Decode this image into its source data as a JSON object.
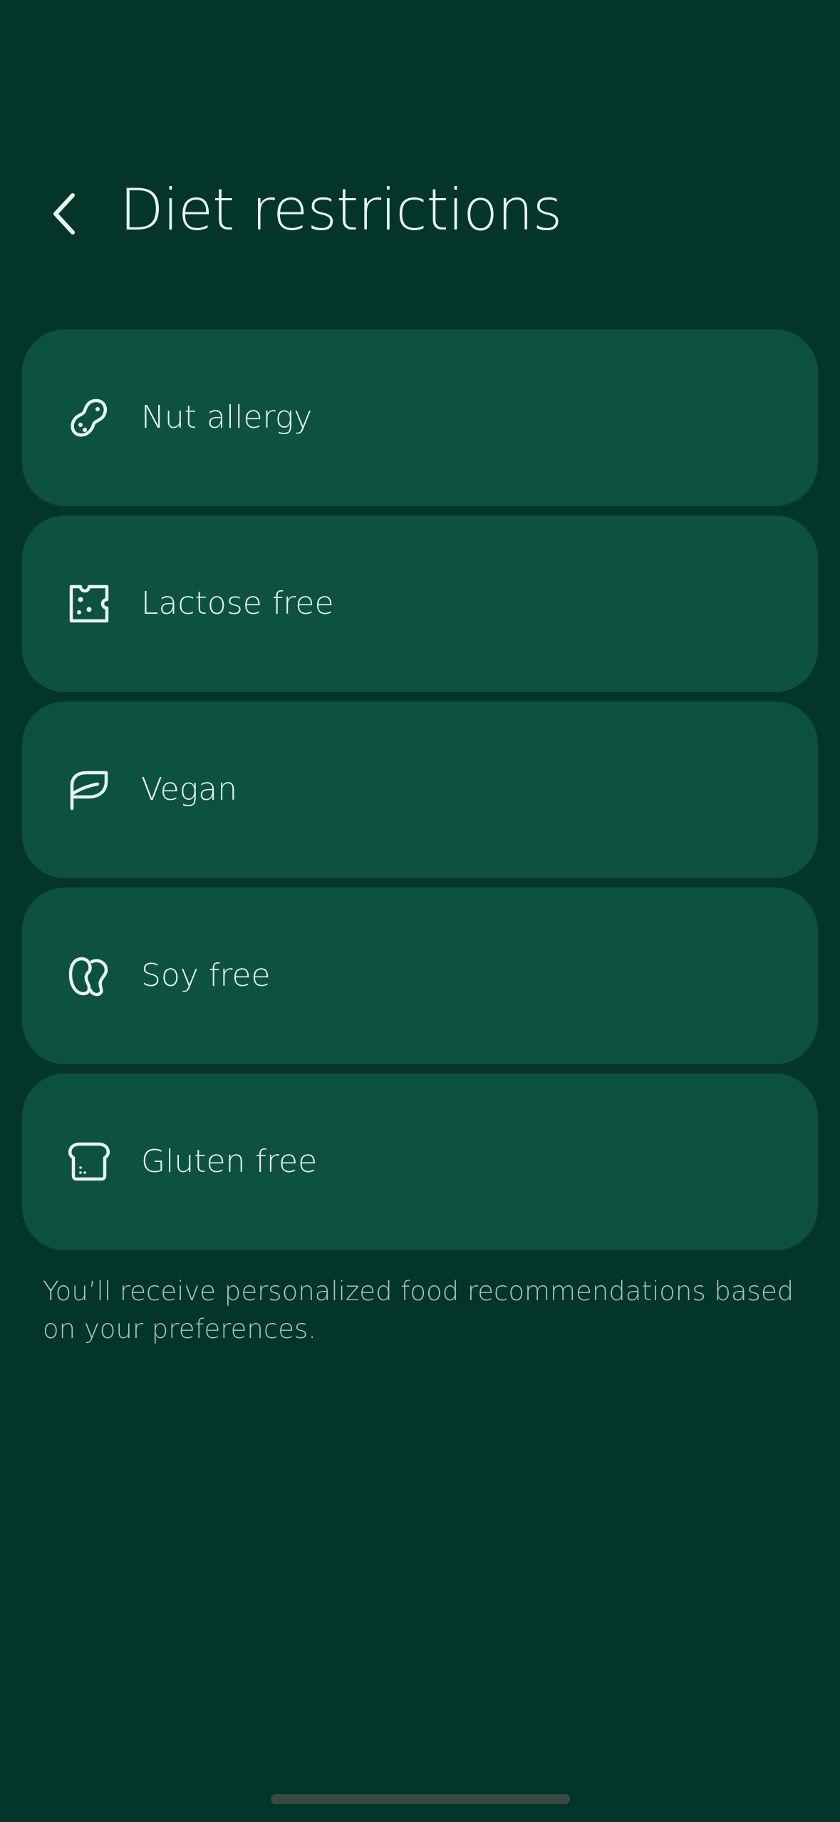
{
  "header": {
    "back_icon": "chevron-left-icon",
    "title": "Diet restrictions"
  },
  "options": [
    {
      "label": "Nut allergy",
      "icon": "peanut-icon"
    },
    {
      "label": "Lactose free",
      "icon": "cheese-icon"
    },
    {
      "label": "Vegan",
      "icon": "leaf-icon"
    },
    {
      "label": "Soy free",
      "icon": "bean-icon"
    },
    {
      "label": "Gluten free",
      "icon": "bread-icon"
    }
  ],
  "footnote": "You’ll receive personalized food recommendations based on your preferences.",
  "colors": {
    "background": "#04352a",
    "card": "#0d5141",
    "text": "#e9f5ef",
    "muted_text": "#a9c8bc"
  }
}
